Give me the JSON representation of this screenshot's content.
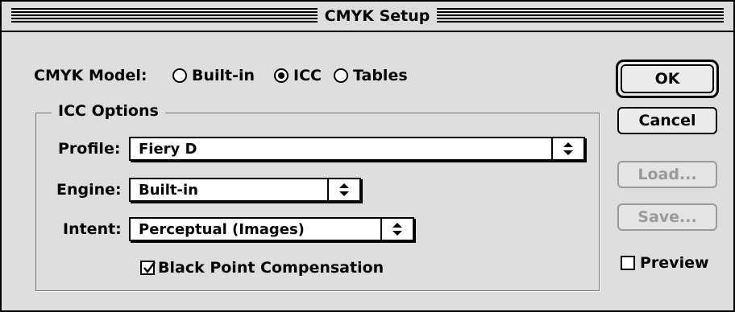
{
  "window": {
    "title": "CMYK Setup"
  },
  "cmyk_model": {
    "label": "CMYK Model:",
    "options": [
      {
        "label": "Built-in",
        "selected": false
      },
      {
        "label": "ICC",
        "selected": true
      },
      {
        "label": "Tables",
        "selected": false
      }
    ]
  },
  "icc_options": {
    "title": "ICC Options",
    "profile": {
      "label": "Profile:",
      "value": "Fiery D"
    },
    "engine": {
      "label": "Engine:",
      "value": "Built-in"
    },
    "intent": {
      "label": "Intent:",
      "value": "Perceptual (Images)"
    },
    "black_point": {
      "label": "Black Point Compensation",
      "checked": true
    }
  },
  "buttons": {
    "ok": "OK",
    "cancel": "Cancel",
    "load": "Load...",
    "save": "Save..."
  },
  "preview": {
    "label": "Preview",
    "checked": false
  }
}
